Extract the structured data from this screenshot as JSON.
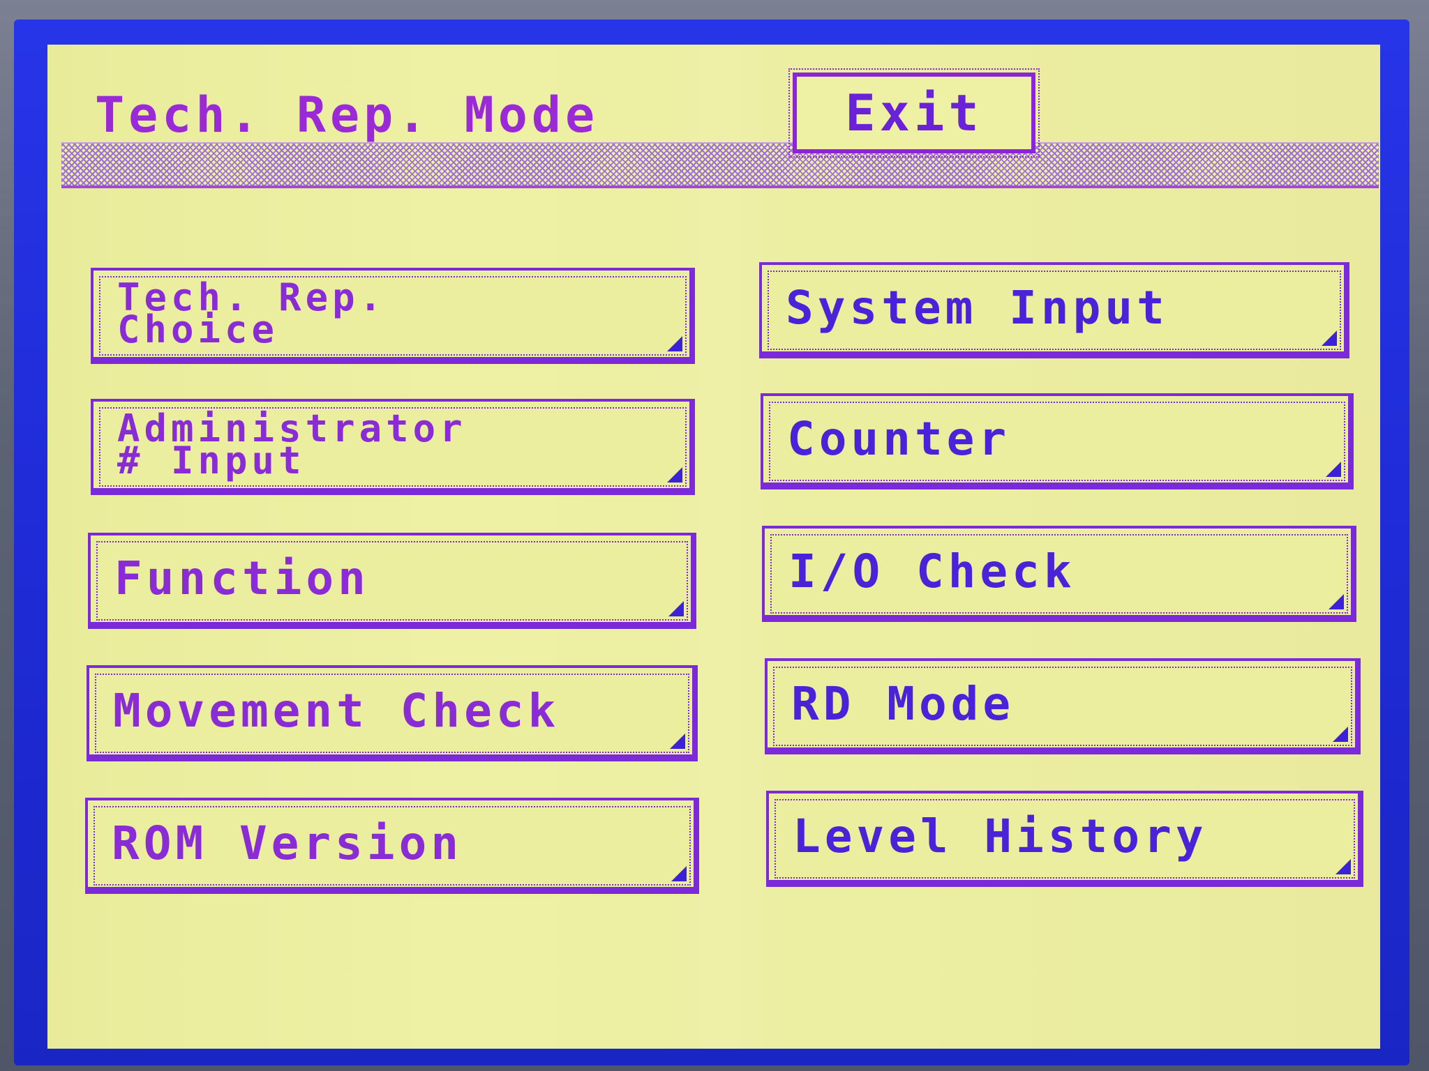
{
  "screen": {
    "title": "Tech. Rep. Mode",
    "exit_label": "Exit"
  },
  "menu": {
    "left": [
      {
        "label": "Tech. Rep.\nChoice"
      },
      {
        "label": "Administrator\n# Input"
      },
      {
        "label": "Function"
      },
      {
        "label": "Movement Check"
      },
      {
        "label": "ROM Version"
      }
    ],
    "right": [
      {
        "label": "System Input"
      },
      {
        "label": "Counter"
      },
      {
        "label": "I/O Check"
      },
      {
        "label": "RD Mode"
      },
      {
        "label": "Level History"
      }
    ]
  },
  "colors": {
    "lcd_background": "#eef0a4",
    "text_purple": "#8a2cd6",
    "text_blue_violet": "#4a22d8",
    "bezel_blue": "#2735e8"
  }
}
